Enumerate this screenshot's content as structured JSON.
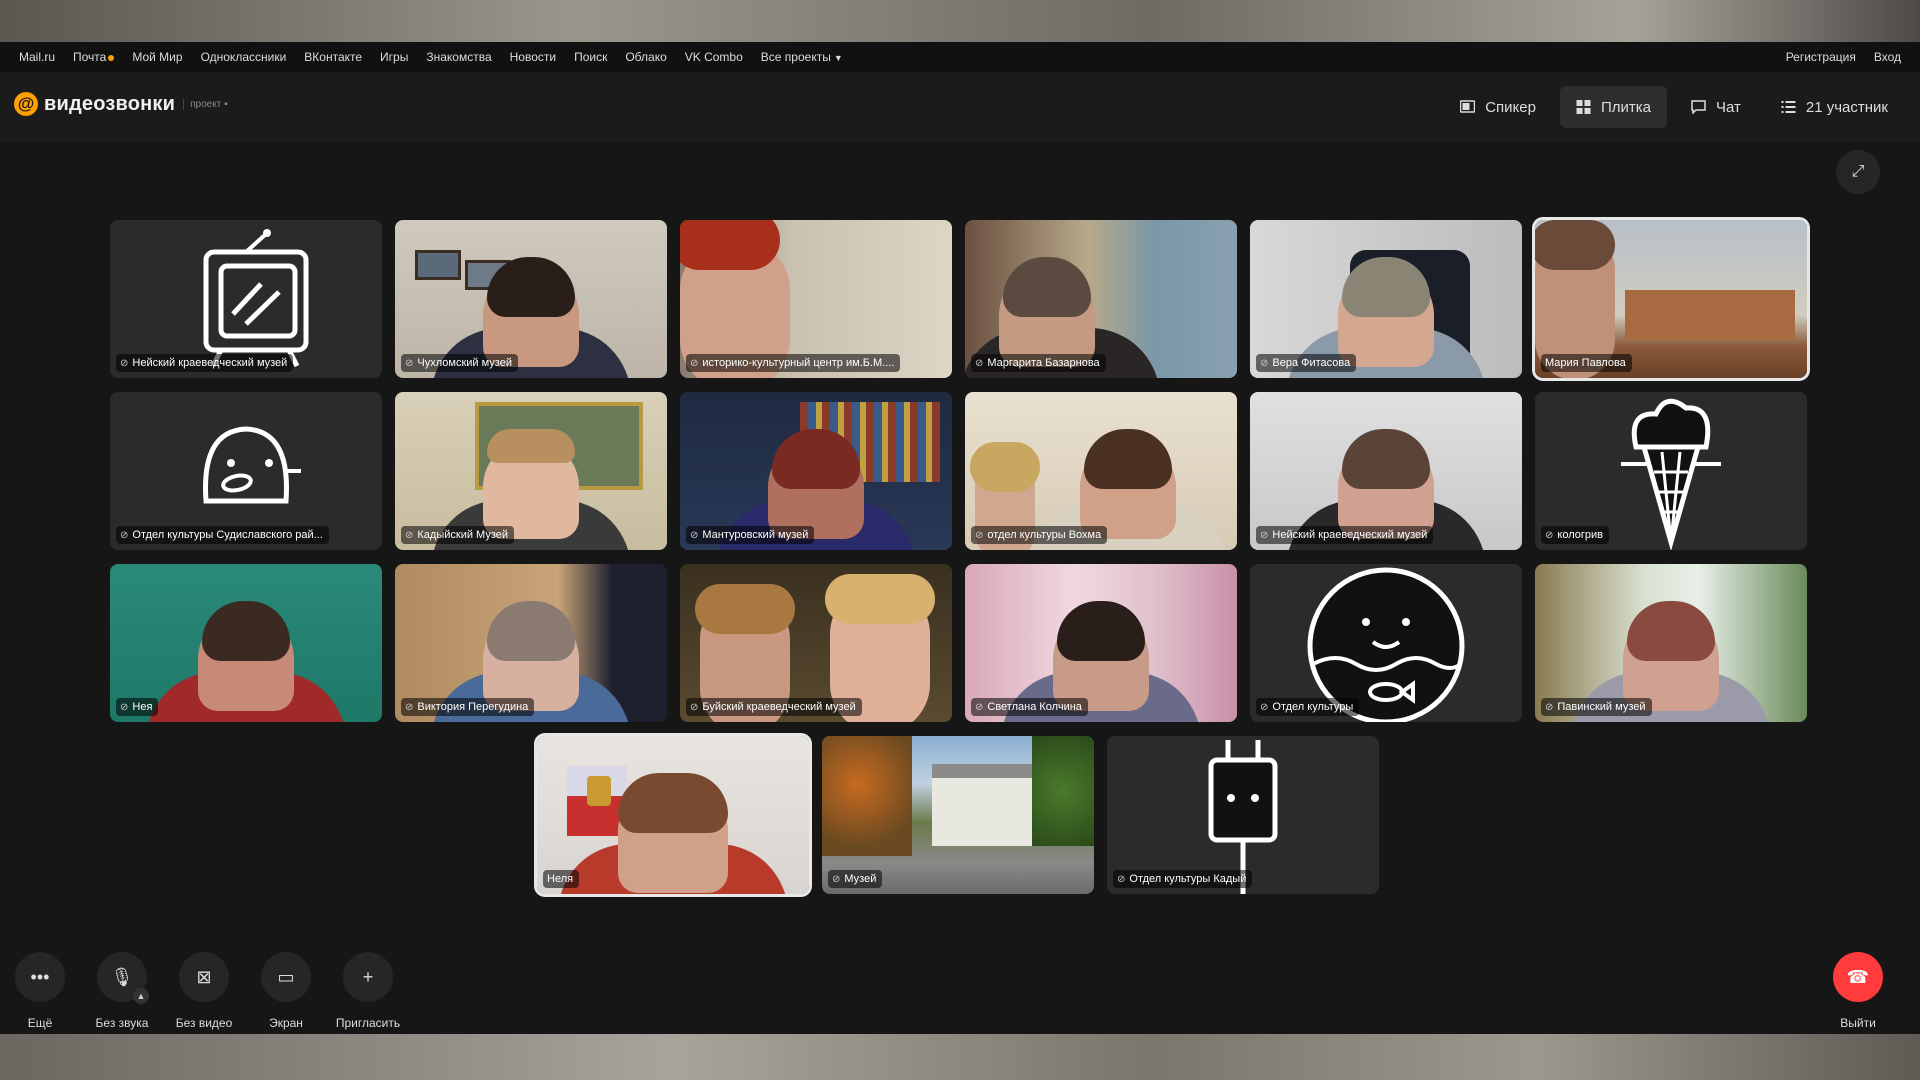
{
  "portal": {
    "items": [
      "Mail.ru",
      "Почта",
      "Мой Мир",
      "Одноклассники",
      "ВКонтакте",
      "Игры",
      "Знакомства",
      "Новости",
      "Поиск",
      "Облако",
      "VK Combo",
      "Все проекты"
    ],
    "register": "Регистрация",
    "login": "Вход"
  },
  "header": {
    "logo": "видеозвонки",
    "project_badge": "проект",
    "views": {
      "speaker": "Спикер",
      "tile": "Плитка",
      "chat": "Чат",
      "participants": "21 участник"
    },
    "active_view": "tile"
  },
  "tiles": [
    {
      "name": "Нейский краеведческий музей",
      "kind": "avatar",
      "icon": "tv-icon"
    },
    {
      "name": "Чухломский музей",
      "kind": "video"
    },
    {
      "name": "историко-культурный центр им.Б.М....",
      "kind": "video"
    },
    {
      "name": "Маргарита Базарнова",
      "kind": "video"
    },
    {
      "name": "Вера Фитасова",
      "kind": "video"
    },
    {
      "name": "Мария Павлова",
      "kind": "video",
      "speaking": true
    },
    {
      "name": "Отдел культуры Судиславского рай...",
      "kind": "avatar",
      "icon": "egg-face-icon"
    },
    {
      "name": "Кадыйский Музей",
      "kind": "video"
    },
    {
      "name": "Мантуровский музей",
      "kind": "video"
    },
    {
      "name": "отдел культуры Вохма",
      "kind": "video"
    },
    {
      "name": "Нейский краеведческий музей",
      "kind": "video"
    },
    {
      "name": "кологрив",
      "kind": "avatar",
      "icon": "ice-cream-icon"
    },
    {
      "name": "Нея",
      "kind": "video"
    },
    {
      "name": "Виктория Перегудина",
      "kind": "video"
    },
    {
      "name": "Буйский краеведческий музей",
      "kind": "video"
    },
    {
      "name": "Светлана Колчина",
      "kind": "video"
    },
    {
      "name": "Отдел культуры",
      "kind": "avatar",
      "icon": "fishbowl-icon"
    },
    {
      "name": "Павинский музей",
      "kind": "video"
    },
    {
      "name": "Неля",
      "kind": "video",
      "speaking": true,
      "self": true
    },
    {
      "name": "Музей",
      "kind": "video"
    },
    {
      "name": "Отдел культуры Кадый",
      "kind": "avatar",
      "icon": "plug-icon"
    }
  ],
  "controls": {
    "more": "Ещё",
    "mute": "Без звука",
    "no_video": "Без видео",
    "screen": "Экран",
    "invite": "Пригласить",
    "leave": "Выйти"
  },
  "colors": {
    "accent_orange": "#ff9e00",
    "leave_red": "#ff3b3b",
    "app_bg": "#161616"
  }
}
